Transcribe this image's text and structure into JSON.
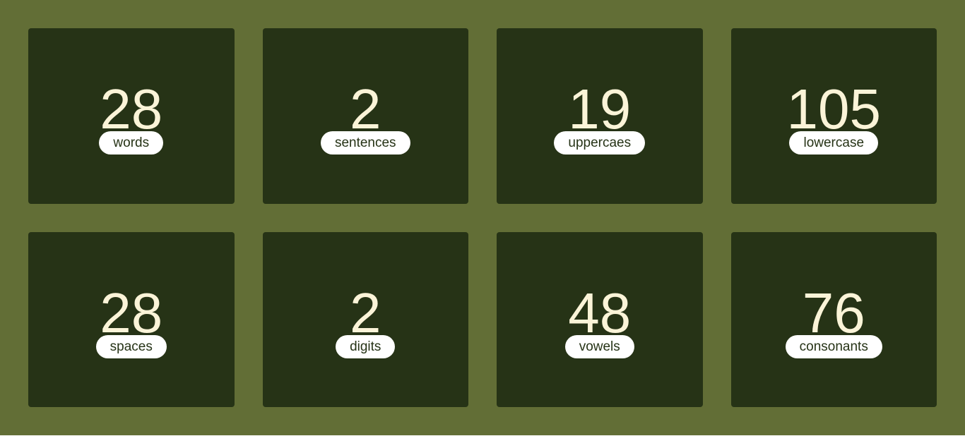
{
  "colors": {
    "background": "#626e36",
    "card": "#263316",
    "value_text": "#fbf4d8",
    "label_bg": "#ffffff",
    "label_text": "#263316"
  },
  "stats": [
    {
      "value": "28",
      "label": "words"
    },
    {
      "value": "2",
      "label": "sentences"
    },
    {
      "value": "19",
      "label": "uppercaes"
    },
    {
      "value": "105",
      "label": "lowercase"
    },
    {
      "value": "28",
      "label": "spaces"
    },
    {
      "value": "2",
      "label": "digits"
    },
    {
      "value": "48",
      "label": "vowels"
    },
    {
      "value": "76",
      "label": "consonants"
    }
  ]
}
